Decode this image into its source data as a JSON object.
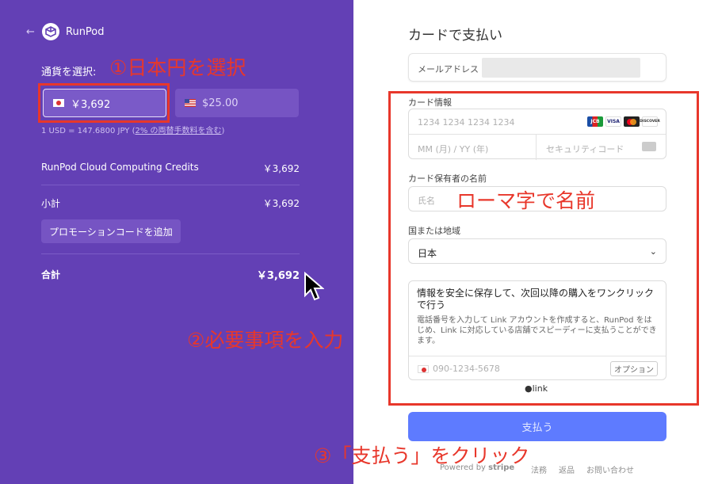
{
  "left_panel": {
    "back_arrow": "←",
    "brand": "RunPod",
    "currency_label": "通貨を選択:",
    "currency_options": [
      {
        "flag": "jp-flag-icon",
        "label": "￥3,692",
        "selected": true
      },
      {
        "flag": "us-flag-icon",
        "label": "$25.00",
        "selected": false
      }
    ],
    "exchange_rate_prefix": "1 USD = 147.6800 JPY (",
    "exchange_rate_link": "2% の両替手数料を含む",
    "exchange_rate_suffix": ")",
    "line_item": {
      "label": "RunPod Cloud Computing Credits",
      "amount": "￥3,692"
    },
    "subtotal": {
      "label": "小計",
      "amount": "￥3,692"
    },
    "promo_button": "プロモーションコードを追加",
    "total": {
      "label": "合計",
      "amount": "￥3,692"
    },
    "colors": {
      "background": "#6340b5"
    }
  },
  "right_panel": {
    "title": "カードで支払い",
    "email_label": "メールアドレス",
    "card_label": "カード情報",
    "card_number_placeholder": "1234 1234 1234 1234",
    "expiry_placeholder": "MM (月) / YY (年)",
    "cvc_placeholder": "セキュリティコード",
    "card_brands": [
      "JCB",
      "VISA",
      "MC",
      "DISCOVER"
    ],
    "cardholder_label": "カード保有者の名前",
    "cardholder_placeholder": "氏名",
    "country_label": "国または地域",
    "country_value": "日本",
    "link_title": "情報を安全に保存して、次回以降の購入をワンクリックで行う",
    "link_description": "電話番号を入力して Link アカウントを作成すると、RunPod をはじめ、Link に対応している店舗でスピーディーに支払うことができます。",
    "phone_placeholder": "090-1234-5678",
    "optional_badge": "オプション",
    "link_logo": "link",
    "pay_button": "支払う",
    "footer": {
      "powered_by": "Powered by",
      "stripe": "stripe",
      "terms": "法務",
      "refunds": "返品",
      "contact": "お問い合わせ"
    },
    "colors": {
      "pay_button": "#5e7bff"
    }
  },
  "annotations": {
    "step1": "①日本円を選択",
    "name_hint": "ローマ字で名前",
    "step2": "②必要事項を入力",
    "step3": "③「支払う」をクリック",
    "color": "#e8372b"
  }
}
